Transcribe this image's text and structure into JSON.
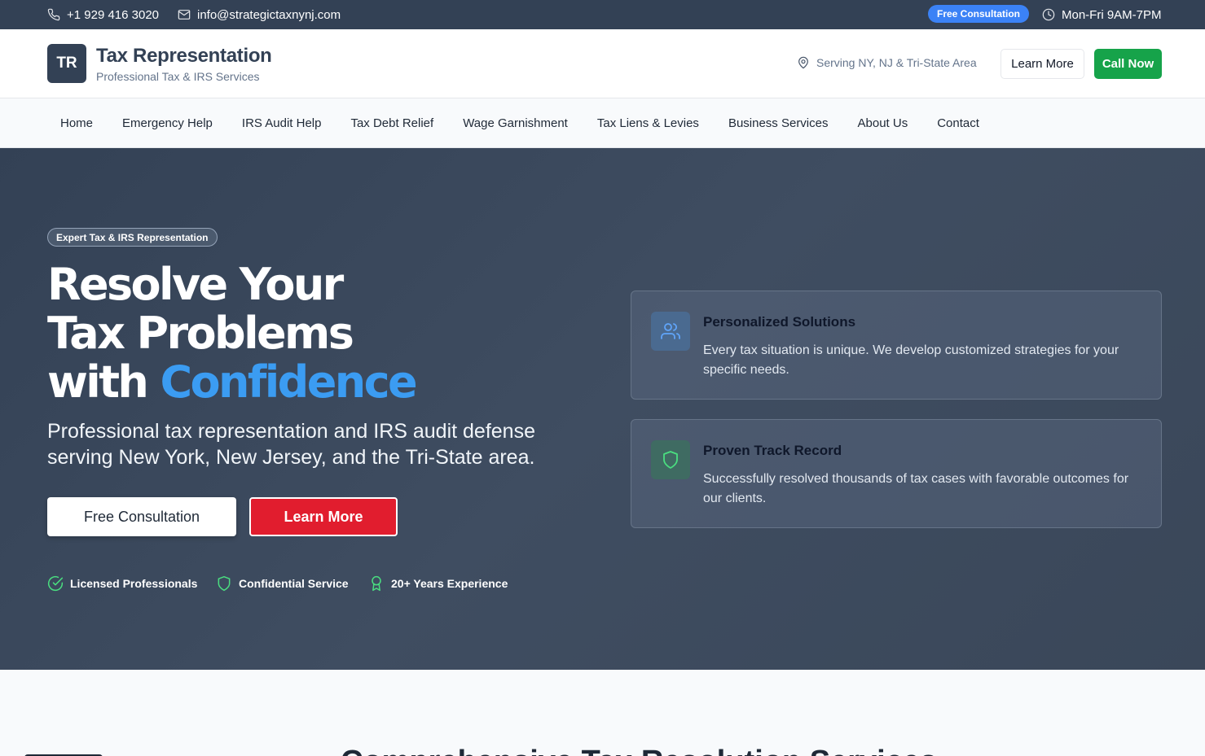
{
  "topbar": {
    "phone": "+1 929 416 3020",
    "email": "info@strategictaxnynj.com",
    "consult_pill": "Free Consultation",
    "hours": "Mon-Fri 9AM-7PM"
  },
  "header": {
    "logo_initials": "TR",
    "title": "Tax Representation",
    "subtitle": "Professional Tax & IRS Services",
    "serving": "Serving NY, NJ & Tri-State Area",
    "learn_more": "Learn More",
    "call_now": "Call Now"
  },
  "nav": {
    "items": [
      {
        "label": "Home"
      },
      {
        "label": "Emergency Help"
      },
      {
        "label": "IRS Audit Help"
      },
      {
        "label": "Tax Debt Relief"
      },
      {
        "label": "Wage Garnishment"
      },
      {
        "label": "Tax Liens & Levies"
      },
      {
        "label": "Business Services"
      },
      {
        "label": "About Us"
      },
      {
        "label": "Contact"
      }
    ]
  },
  "hero": {
    "badge": "Expert Tax & IRS Representation",
    "heading_line1": "Resolve Your",
    "heading_line2": "Tax Problems",
    "heading_line3_plain": "with ",
    "heading_line3_accent": "Confidence",
    "lead": "Professional tax representation and IRS audit defense serving New York, New Jersey, and the Tri-State area.",
    "btn_free": "Free Consultation",
    "btn_learn": "Learn More",
    "trust": [
      {
        "label": "Licensed Professionals",
        "icon": "check-circle-icon"
      },
      {
        "label": "Confidential Service",
        "icon": "shield-icon"
      },
      {
        "label": "20+ Years Experience",
        "icon": "award-icon"
      }
    ],
    "cards": [
      {
        "title": "Personalized Solutions",
        "desc": "Every tax situation is unique. We develop customized strategies for your specific needs.",
        "icon": "users-icon"
      },
      {
        "title": "Proven Track Record",
        "desc": "Successfully resolved thousands of tax cases with favorable outcomes for our clients.",
        "icon": "shield-icon"
      }
    ]
  },
  "next_section": {
    "title": "Comprehensive Tax Resolution Services"
  },
  "colors": {
    "dark": "#334155",
    "accent_blue": "#3b9cf2",
    "call_green": "#16a34a",
    "learn_red": "#e11d2e",
    "trust_green": "#4ade80"
  }
}
